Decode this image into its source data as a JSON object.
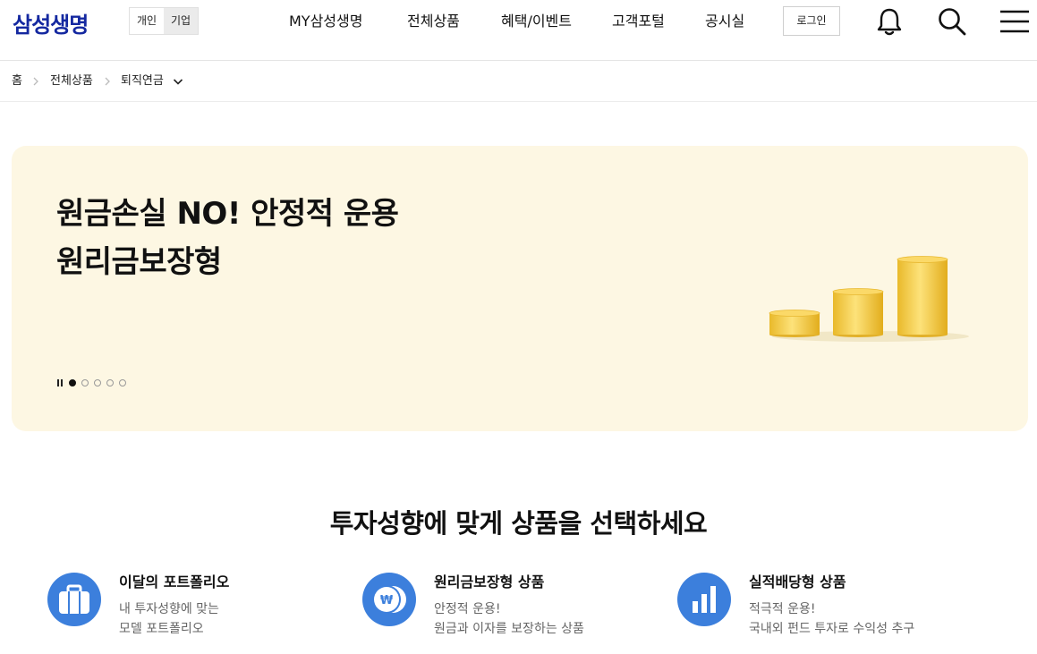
{
  "header": {
    "logo": "삼성생명",
    "segment": {
      "personal": "개인",
      "corporate": "기업"
    },
    "nav": [
      "MY삼성생명",
      "전체상품",
      "혜택/이벤트",
      "고객포털",
      "공시실"
    ],
    "login": "로그인",
    "icons": [
      "bell-icon",
      "search-icon",
      "menu-icon"
    ]
  },
  "breadcrumb": {
    "home": "홈",
    "level1": "전체상품",
    "level2": "퇴직연금"
  },
  "banner": {
    "line1": "원금손실 NO! 안정적 운용",
    "line2": "원리금보장형",
    "slides_total": 5,
    "active_slide": 1,
    "background": "#fdf7e3"
  },
  "section": {
    "title": "투자성향에 맞게 상품을 선택하세요",
    "cards": [
      {
        "title": "이달의 포트폴리오",
        "desc1": "내 투자성향에 맞는",
        "desc2": "모델 포트폴리오",
        "icon": "briefcase-icon"
      },
      {
        "title": "원리금보장형 상품",
        "desc1": "안정적 운용!",
        "desc2": "원금과 이자를 보장하는 상품",
        "icon": "won-coin-icon"
      },
      {
        "title": "실적배당형 상품",
        "desc1": "적극적 운용!",
        "desc2": "국내외 펀드 투자로 수익성 추구",
        "icon": "bar-chart-icon"
      }
    ]
  },
  "colors": {
    "brand": "#1428a0",
    "accent": "#3c7fdc"
  }
}
